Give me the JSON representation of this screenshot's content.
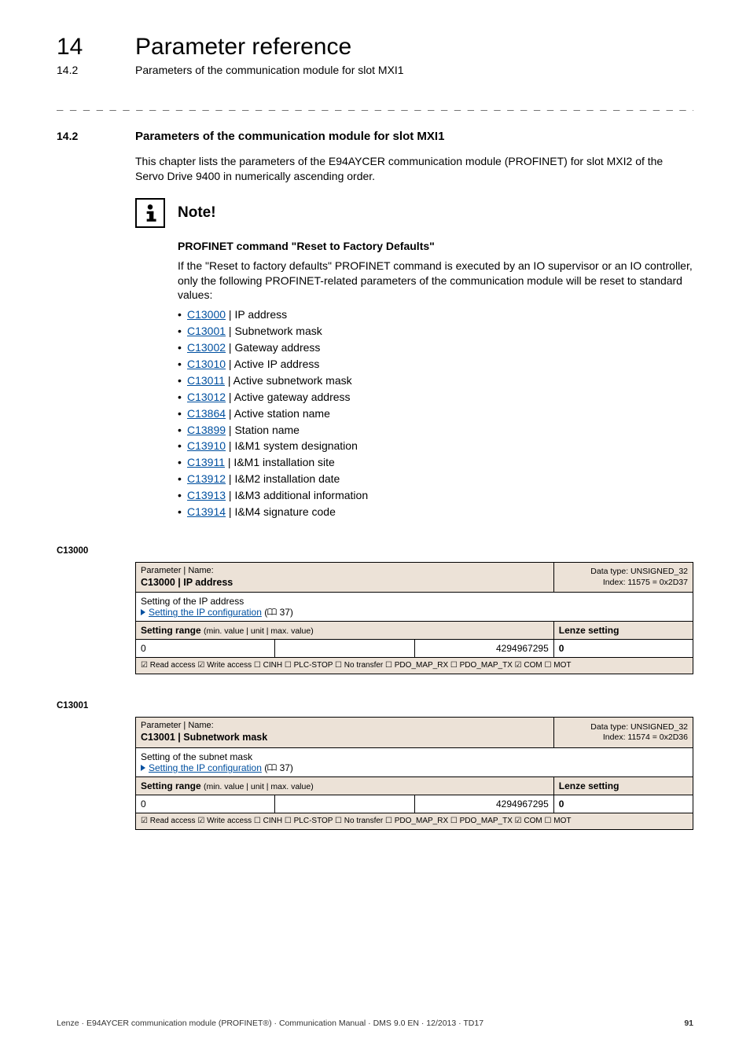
{
  "header": {
    "chapter_number": "14",
    "chapter_title": "Parameter reference",
    "sub_number": "14.2",
    "sub_title": "Parameters of the communication module for slot MXI1"
  },
  "dashes": "_ _ _ _ _ _ _ _ _ _ _ _ _ _ _ _ _ _ _ _ _ _ _ _ _ _ _ _ _ _ _ _ _ _ _ _ _ _ _ _ _ _ _ _ _ _ _ _ _ _ _ _ _ _ _ _ _ _ _ _ _ _ _ _",
  "section": {
    "number": "14.2",
    "title": "Parameters of the communication module for slot MXI1",
    "intro": "This chapter lists the parameters of the E94AYCER communication module (PROFINET) for slot MXI2 of the Servo Drive 9400 in numerically ascending order."
  },
  "note": {
    "title": "Note!",
    "subtitle": "PROFINET command \"Reset to Factory Defaults\"",
    "para": "If the \"Reset to factory defaults\" PROFINET command is executed by an IO supervisor or an IO controller, only the following PROFINET-related parameters of the communication module will be reset to standard values:",
    "items": [
      {
        "code": "C13000",
        "text": " | IP address"
      },
      {
        "code": "C13001",
        "text": " | Subnetwork mask"
      },
      {
        "code": "C13002",
        "text": " | Gateway address"
      },
      {
        "code": "C13010",
        "text": " | Active IP address"
      },
      {
        "code": "C13011",
        "text": " | Active subnetwork mask"
      },
      {
        "code": "C13012",
        "text": " | Active gateway address"
      },
      {
        "code": "C13864",
        "text": " | Active station name"
      },
      {
        "code": "C13899",
        "text": " | Station name"
      },
      {
        "code": "C13910",
        "text": " | I&M1 system designation"
      },
      {
        "code": "C13911",
        "text": " | I&M1 installation site"
      },
      {
        "code": "C13912",
        "text": " | I&M2 installation date"
      },
      {
        "code": "C13913",
        "text": " | I&M3 additional information"
      },
      {
        "code": "C13914",
        "text": " | I&M4 signature code"
      }
    ]
  },
  "params": [
    {
      "anchor": "C13000",
      "header_left_label": "Parameter | Name:",
      "header_left_value": "C13000 | IP address",
      "header_right_l1": "Data type: UNSIGNED_32",
      "header_right_l2": "Index: 11575 = 0x2D37",
      "desc_line1": "Setting of the IP address",
      "desc_link": "Setting the IP configuration",
      "desc_link_page": "37",
      "range_label": "Setting range",
      "range_sub": "(min. value | unit | max. value)",
      "lenze_label": "Lenze setting",
      "min": "0",
      "unit": "",
      "max": "4294967295",
      "default": "0",
      "checks": "☑ Read access   ☑ Write access   ☐ CINH   ☐ PLC-STOP   ☐ No transfer   ☐ PDO_MAP_RX   ☐ PDO_MAP_TX   ☑ COM   ☐ MOT"
    },
    {
      "anchor": "C13001",
      "header_left_label": "Parameter | Name:",
      "header_left_value": "C13001 | Subnetwork mask",
      "header_right_l1": "Data type: UNSIGNED_32",
      "header_right_l2": "Index: 11574 = 0x2D36",
      "desc_line1": "Setting of the subnet mask",
      "desc_link": "Setting the IP configuration",
      "desc_link_page": "37",
      "range_label": "Setting range",
      "range_sub": "(min. value | unit | max. value)",
      "lenze_label": "Lenze setting",
      "min": "0",
      "unit": "",
      "max": "4294967295",
      "default": "0",
      "checks": "☑ Read access   ☑ Write access   ☐ CINH   ☐ PLC-STOP   ☐ No transfer   ☐ PDO_MAP_RX   ☐ PDO_MAP_TX   ☑ COM   ☐ MOT"
    }
  ],
  "footer": {
    "left": "Lenze · E94AYCER communication module (PROFINET®) · Communication Manual · DMS 9.0 EN · 12/2013 · TD17",
    "right": "91"
  }
}
